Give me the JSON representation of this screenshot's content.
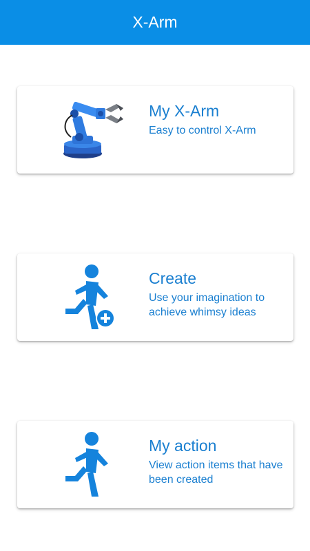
{
  "appbar": {
    "title": "X-Arm",
    "color": "#0a8ee6"
  },
  "cards": [
    {
      "heading": "My X-Arm",
      "description": "Easy to control X-Arm",
      "icon": "robot-arm-image"
    },
    {
      "heading": "Create",
      "description": "Use your imagination to achieve whimsy ideas",
      "icon": "running-person-plus-icon"
    },
    {
      "heading": "My action",
      "description": "View action items that have been created",
      "icon": "running-person-icon"
    }
  ],
  "colors": {
    "accent": "#1a7fd0",
    "icon": "#1583dc"
  }
}
